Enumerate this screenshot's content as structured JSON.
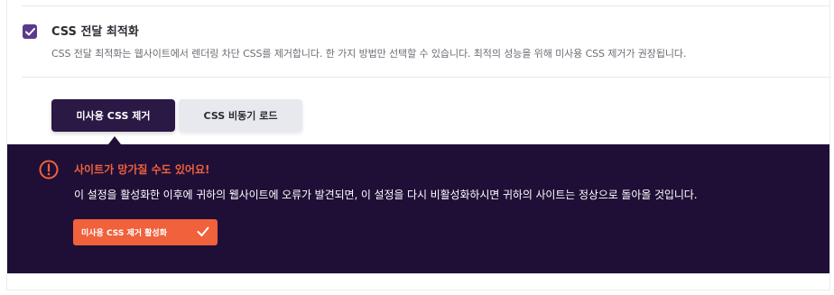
{
  "option": {
    "checked": true,
    "title": "CSS 전달 최적화",
    "description": "CSS 전달 최적화는 웹사이트에서 렌더링 차단 CSS를 제거합니다. 한 가지 방법만 선택할 수 있습니다. 최적의 성능을 위해 미사용 CSS 제거가 권장됩니다."
  },
  "tabs": [
    {
      "label": "미사용 CSS 제거",
      "active": true
    },
    {
      "label": "CSS 비동기 로드",
      "active": false
    }
  ],
  "warning": {
    "icon": "exclamation-circle-icon",
    "title": "사이트가 망가질 수도 있어요!",
    "description": "이 설정을 활성화한 이후에 귀하의 웹사이트에 오류가 발견되면, 이 설정을 다시 비활성화하시면 귀하의 사이트는 정상으로 돌아올 것입니다.",
    "button_label": "미사용 CSS 제거 활성화",
    "button_icon": "checkmark-icon"
  },
  "colors": {
    "accent_purple": "#5a3a8a",
    "dark_panel": "#1f0f37",
    "active_tab": "#2a1845",
    "warning_orange": "#f0613c"
  }
}
